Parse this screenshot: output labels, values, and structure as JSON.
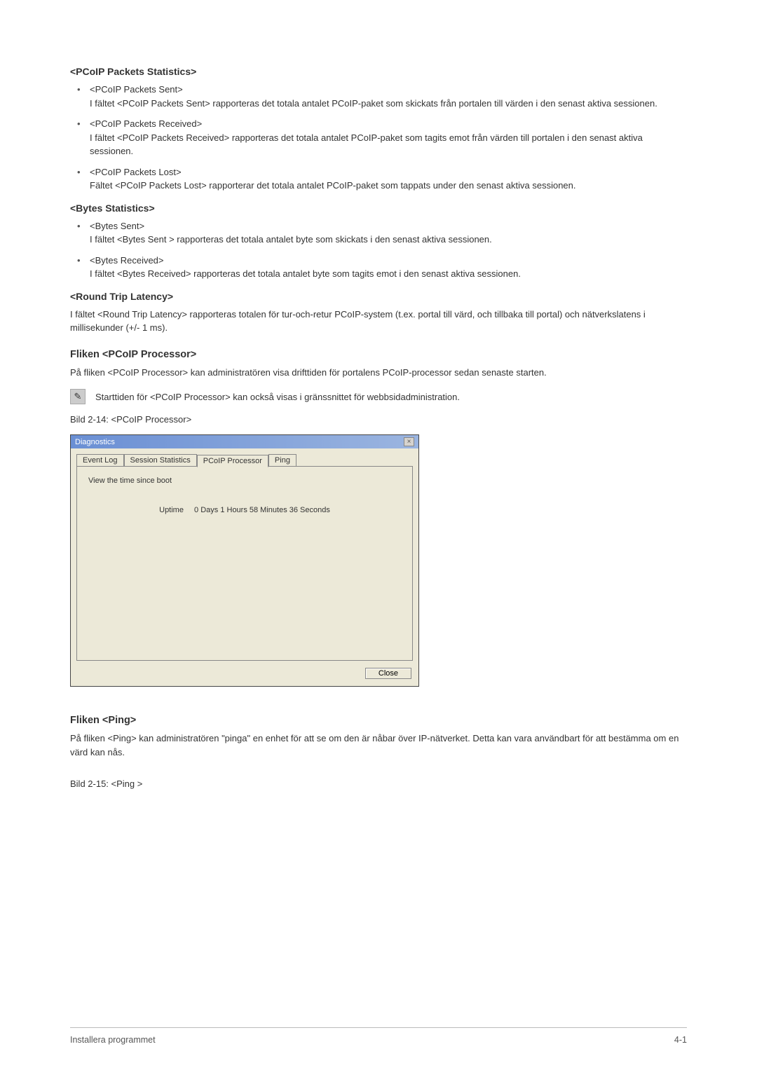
{
  "sections": {
    "pcoip_packets_stats": {
      "heading": "<PCoIP Packets Statistics>",
      "items": [
        {
          "title": "<PCoIP Packets Sent>",
          "body": "I fältet <PCoIP Packets Sent> rapporteras det totala antalet PCoIP-paket som skickats från portalen till värden i den senast aktiva sessionen."
        },
        {
          "title": "<PCoIP Packets Received>",
          "body": "I fältet <PCoIP Packets Received> rapporteras det totala antalet PCoIP-paket som tagits emot från värden till portalen i den senast aktiva sessionen."
        },
        {
          "title": "<PCoIP Packets Lost>",
          "body": "Fältet <PCoIP Packets Lost> rapporterar det totala antalet PCoIP-paket som tappats under den senast aktiva sessionen."
        }
      ]
    },
    "bytes_stats": {
      "heading": "<Bytes Statistics>",
      "items": [
        {
          "title": "<Bytes Sent>",
          "body": "I fältet <Bytes Sent > rapporteras det totala antalet byte som skickats i den senast aktiva sessionen."
        },
        {
          "title": "<Bytes Received>",
          "body": "I fältet <Bytes Received> rapporteras det totala antalet byte som tagits emot i den senast aktiva sessionen."
        }
      ]
    },
    "round_trip": {
      "heading": "<Round Trip Latency>",
      "body": "I fältet <Round Trip Latency> rapporteras totalen för tur-och-retur PCoIP-system (t.ex. portal till värd, och tillbaka till portal) och nätverkslatens i millisekunder (+/- 1 ms)."
    },
    "pcoip_processor": {
      "heading": "Fliken <PCoIP Processor>",
      "intro": "På fliken <PCoIP Processor> kan administratören visa drifttiden för portalens PCoIP-processor sedan senaste starten.",
      "note": "Starttiden för <PCoIP Processor> kan också visas i gränssnittet för webbsidadministration.",
      "caption": "Bild 2-14: <PCoIP Processor>"
    },
    "ping": {
      "heading": "Fliken <Ping>",
      "intro": "På fliken <Ping> kan administratören \"pinga\" en enhet för att se om den är nåbar över IP-nätverket. Detta kan vara användbart för att bestämma om en värd kan nås.",
      "caption": "Bild 2-15: <Ping >"
    }
  },
  "dialog": {
    "title": "Diagnostics",
    "tabs": [
      {
        "label": "Event Log"
      },
      {
        "label": "Session Statistics"
      },
      {
        "label": "PCoIP Processor"
      },
      {
        "label": "Ping"
      }
    ],
    "active_tab_index": 2,
    "panel": {
      "description": "View the time since boot",
      "uptime_label": "Uptime",
      "uptime_value": "0 Days 1 Hours 58 Minutes 36 Seconds"
    },
    "close_button": "Close"
  },
  "footer": {
    "left": "Installera programmet",
    "right": "4-1"
  },
  "icons": {
    "note_glyph": "✎"
  }
}
